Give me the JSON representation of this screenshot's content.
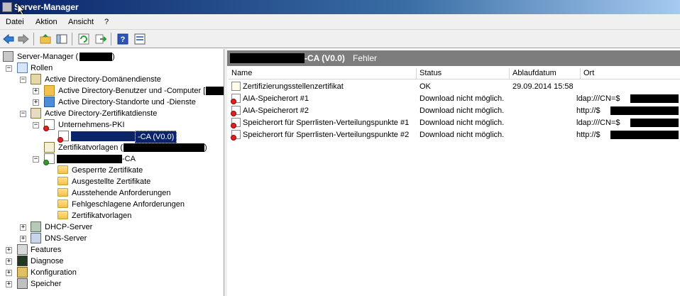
{
  "window": {
    "title": "Server-Manager"
  },
  "menu": [
    "Datei",
    "Aktion",
    "Ansicht",
    "?"
  ],
  "toolbar": {
    "buttons": [
      "back-icon",
      "forward-icon",
      "up-folder-icon",
      "show-hide-tree-icon",
      "refresh-icon",
      "export-icon",
      "help-icon",
      "properties-icon"
    ]
  },
  "tree": {
    "root_label": "Server-Manager (",
    "root_suffix": ")",
    "roles": "Rollen",
    "adds": "Active Directory-Domänendienste",
    "adds_users": "Active Directory-Benutzer und -Computer [",
    "adds_sites": "Active Directory-Standorte und -Dienste",
    "adcs": "Active Directory-Zertifikatdienste",
    "enterprise_pki": "Unternehmens-PKI",
    "pki_ca": "-CA (V0.0)",
    "cert_templates_node": "Zertifikatvorlagen (",
    "cert_templates_suffix": ")",
    "ca_node": "-CA",
    "ca_children": [
      "Gesperrte Zertifikate",
      "Ausgestellte Zertifikate",
      "Ausstehende Anforderungen",
      "Fehlgeschlagene Anforderungen",
      "Zertifikatvorlagen"
    ],
    "dhcp": "DHCP-Server",
    "dns": "DNS-Server",
    "features": "Features",
    "diagnose": "Diagnose",
    "config": "Konfiguration",
    "storage": "Speicher"
  },
  "detail": {
    "ca_name": "-CA (V0.0)",
    "status": "Fehler",
    "columns": [
      "Name",
      "Status",
      "Ablaufdatum",
      "Ort"
    ],
    "rows": [
      {
        "name": "Zertifizierungsstellenzertifikat",
        "status": "OK",
        "expiry": "29.09.2014 15:58",
        "location": ""
      },
      {
        "name": "AIA-Speicherort #1",
        "status": "Download nicht möglich.",
        "expiry": "",
        "location": "ldap:///CN=$"
      },
      {
        "name": "AIA-Speicherort #2",
        "status": "Download nicht möglich.",
        "expiry": "",
        "location": "http://$"
      },
      {
        "name": "Speicherort für Sperrlisten-Verteilungspunkte #1",
        "status": "Download nicht möglich.",
        "expiry": "",
        "location": "ldap:///CN=$"
      },
      {
        "name": "Speicherort für Sperrlisten-Verteilungspunkte #2",
        "status": "Download nicht möglich.",
        "expiry": "",
        "location": "http://$"
      }
    ]
  },
  "colors": {
    "title_start": "#0a246a",
    "header_gray": "#7d7d7d",
    "selection": "#0a246a",
    "error_red": "#d22222"
  }
}
